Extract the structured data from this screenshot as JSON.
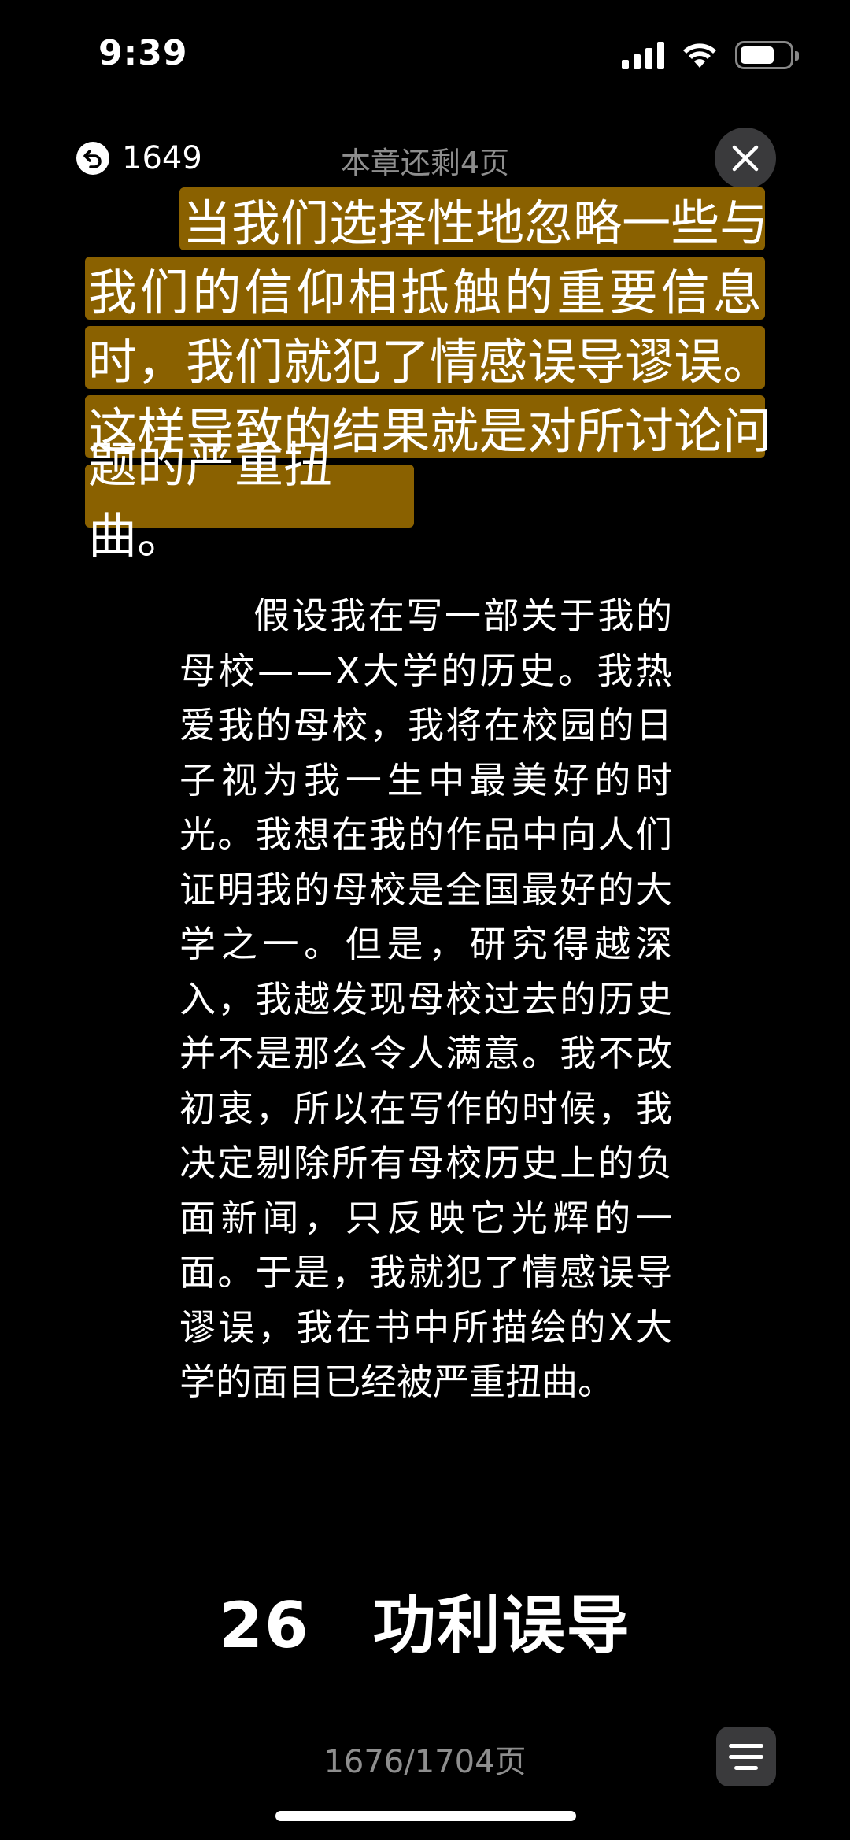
{
  "status_bar": {
    "time": "9:39",
    "icons": [
      "cellular-signal-icon",
      "wifi-icon",
      "battery-icon"
    ]
  },
  "reader_header": {
    "back_count": "1649",
    "back_icon": "return-arrow-icon",
    "chapter_remaining": "本章还剩4页",
    "close_icon": "close-icon"
  },
  "highlighted_paragraph": {
    "highlight_color": "#8a6100",
    "lines": [
      "当我们选择性地忽略一些与",
      "我们的信仰相抵触的重要信息",
      "时，我们就犯了情感误导谬误。",
      "这样导致的结果就是对所讨论问",
      "题的严重扭曲。"
    ]
  },
  "body_paragraph": {
    "lines": [
      "假设我在写一部关于我的",
      "母校——X大学的历史。我热",
      "爱我的母校，我将在校园的日",
      "子视为我一生中最美好的时",
      "光。我想在我的作品中向人们",
      "证明我的母校是全国最好的大",
      "学之一。但是，研究得越深",
      "入，我越发现母校过去的历史",
      "并不是那么令人满意。我不改",
      "初衷，所以在写作的时候，我",
      "决定剔除所有母校历史上的负",
      "面新闻，只反映它光辉的一",
      "面。于是，我就犯了情感误导",
      "谬误，我在书中所描绘的X大",
      "学的面目已经被严重扭曲。"
    ]
  },
  "next_chapter": {
    "number": "26",
    "title": "功利误导"
  },
  "footer": {
    "page_indicator": "1676/1704页",
    "menu_icon": "menu-lines-icon"
  }
}
